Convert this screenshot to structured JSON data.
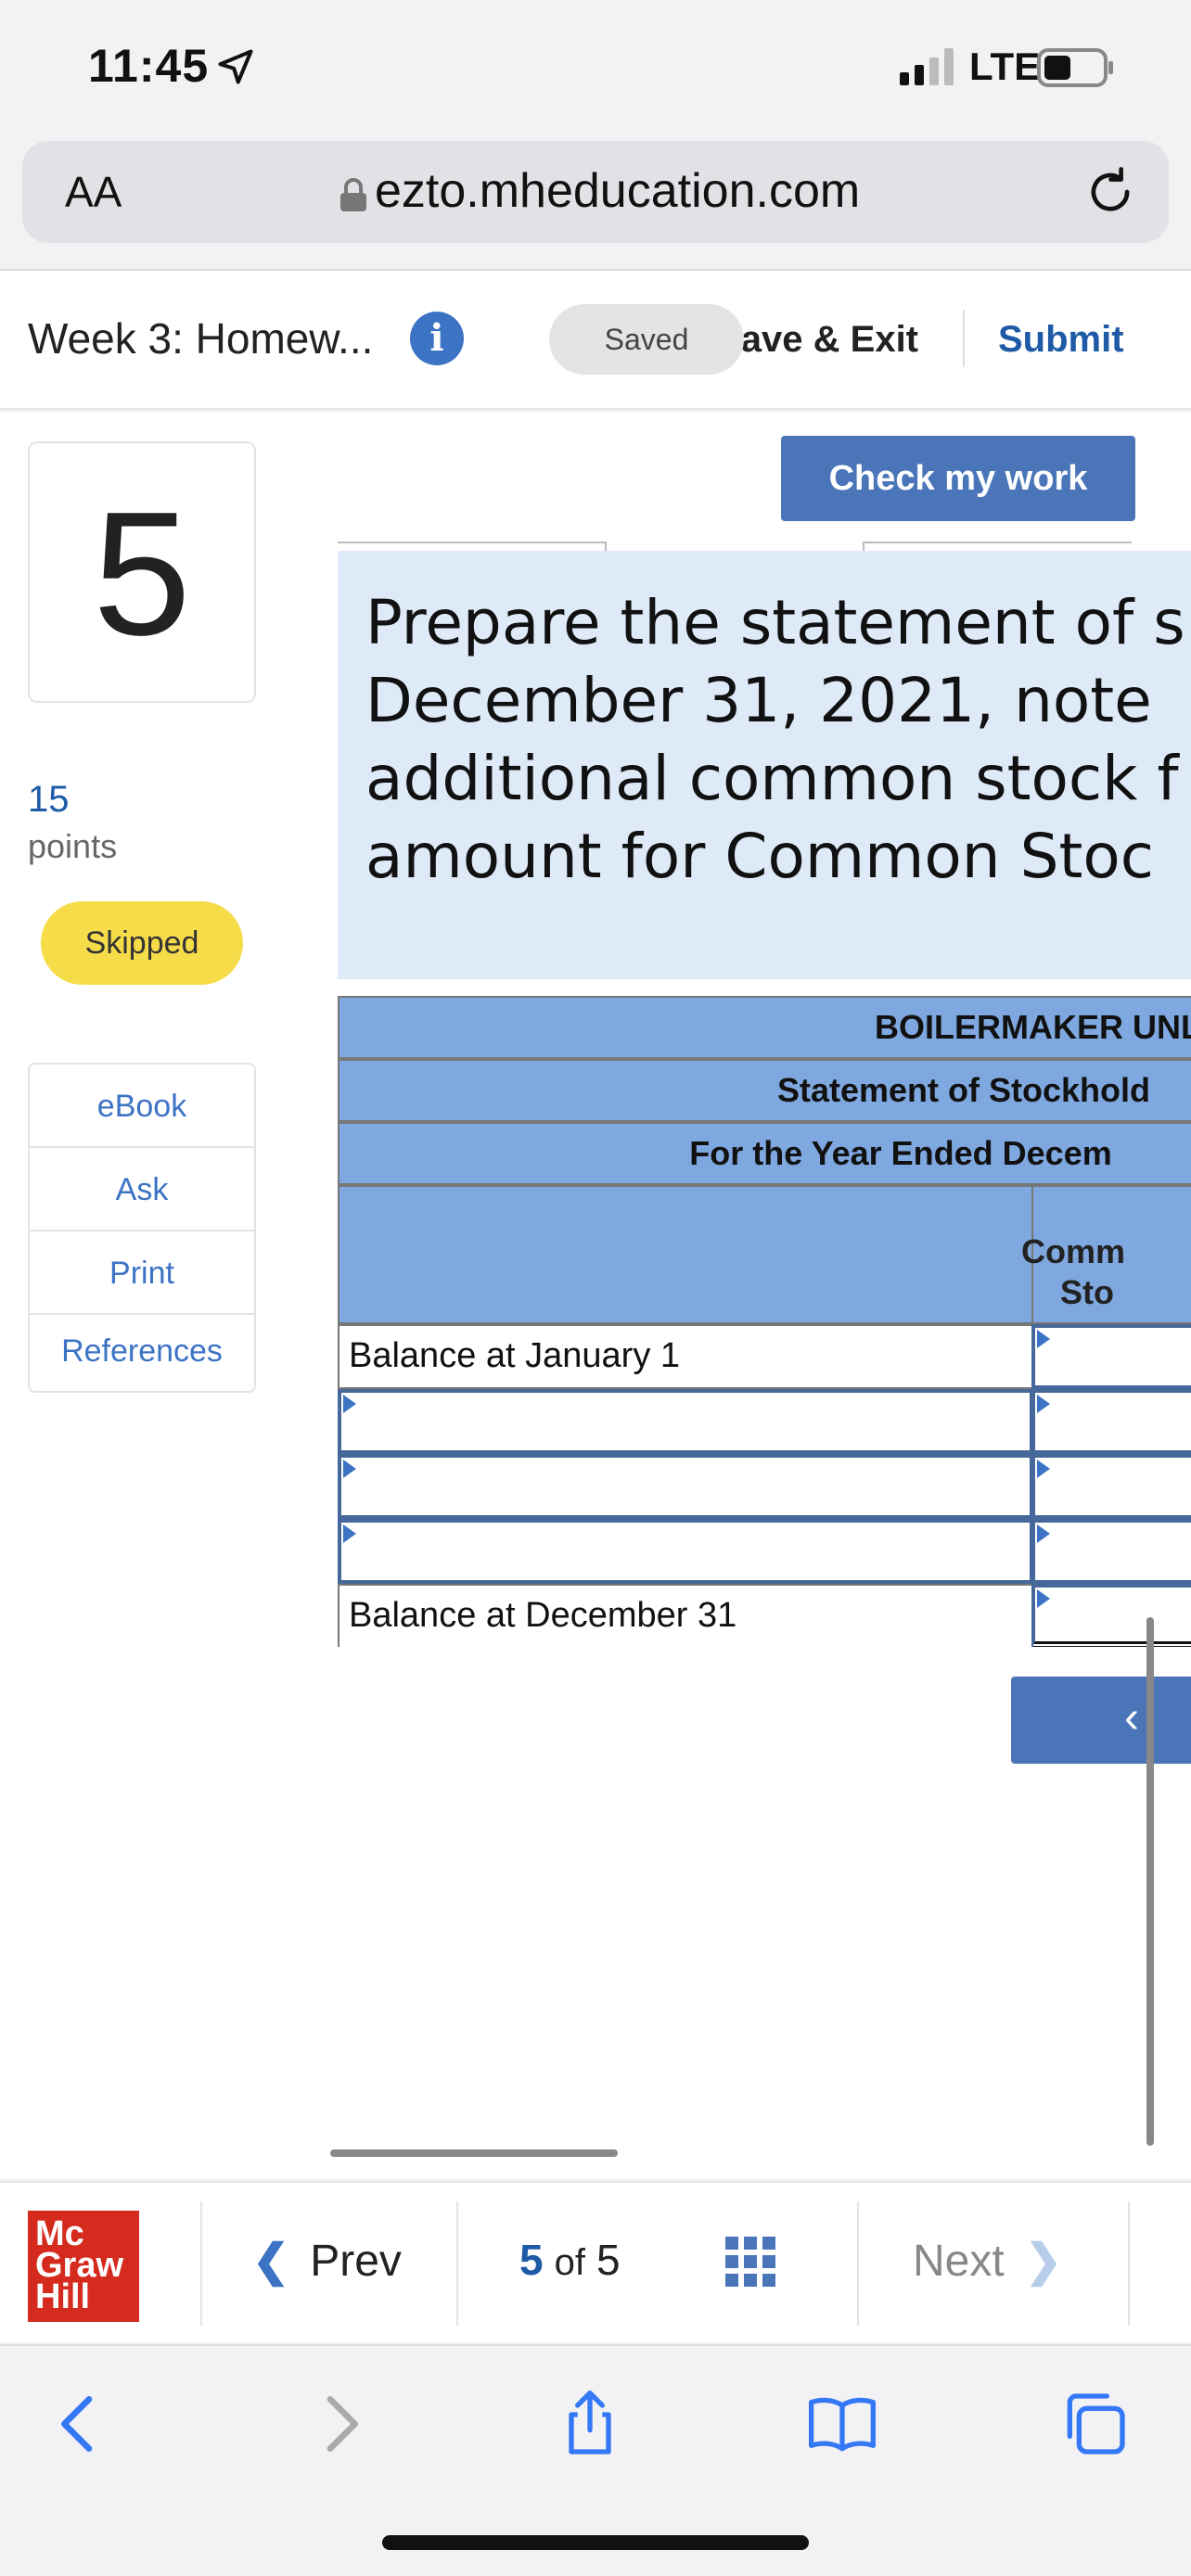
{
  "status_bar": {
    "time": "11:45",
    "network": "LTE"
  },
  "browser": {
    "text_size_label": "AA",
    "url": "ezto.mheducation.com"
  },
  "header": {
    "assignment_title": "Week 3: Homew...",
    "saved_label": "Saved",
    "save_exit_label": "Save & Exit",
    "submit_label": "Submit"
  },
  "question": {
    "number": "5",
    "points": "15",
    "points_label": "points",
    "status": "Skipped"
  },
  "side_menu": {
    "items": [
      {
        "label": "eBook"
      },
      {
        "label": "Ask"
      },
      {
        "label": "Print"
      },
      {
        "label": "References"
      }
    ]
  },
  "check_button_label": "Check my work",
  "prompt": {
    "lines": [
      "Prepare the statement of s",
      "December 31, 2021, note",
      "additional common stock f",
      "amount for Common Stoc"
    ]
  },
  "statement": {
    "company": "BOILERMAKER UNL",
    "title": "Statement of Stockhold",
    "period": "For the Year Ended Decem",
    "column_header_line1": "Comm",
    "column_header_line2": "Sto",
    "rows": [
      {
        "label": "Balance at January 1"
      },
      {
        "label": ""
      },
      {
        "label": ""
      },
      {
        "label": ""
      },
      {
        "label": "Balance at December 31"
      }
    ]
  },
  "pagination_button": "‹",
  "footer": {
    "logo_lines": [
      "Mc",
      "Graw",
      "Hill"
    ],
    "prev_label": "Prev",
    "current_page": "5",
    "of_label": "of",
    "total_pages": "5",
    "next_label": "Next"
  },
  "colors": {
    "accent": "#4a76b9",
    "header_blue": "#7ea8df",
    "prompt_bg": "#dfeaf8",
    "skipped": "#f7dc4a",
    "logo_red": "#d52b1e"
  }
}
